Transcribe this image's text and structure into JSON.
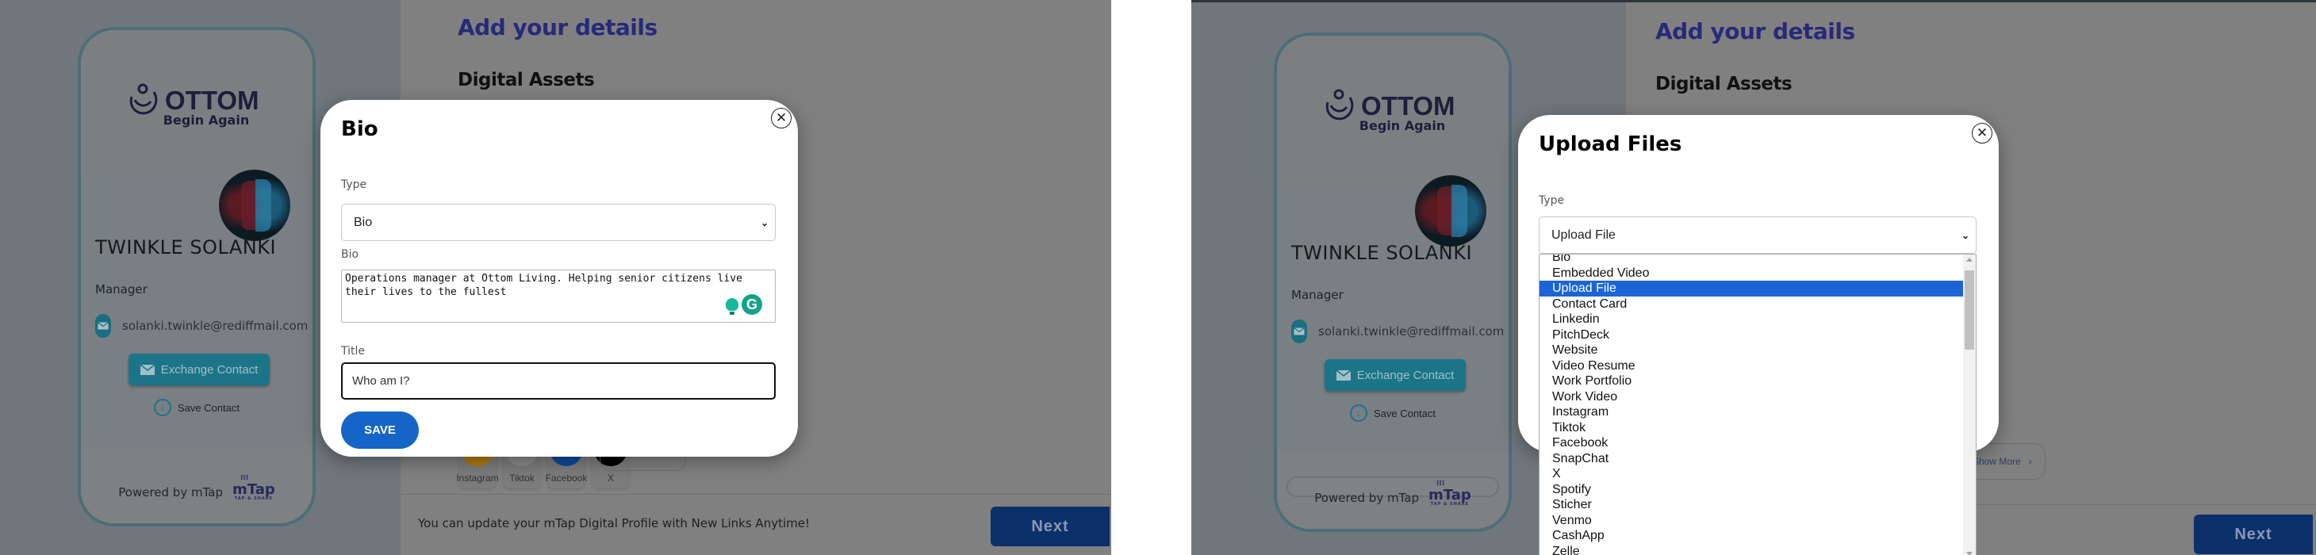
{
  "shared": {
    "profile": {
      "logo_word": "OTTOM",
      "logo_tagline": "Begin Again",
      "name": "TWINKLE SOLANKI",
      "role": "Manager",
      "email": "solanki.twinkle@rediffmail.com",
      "exchange_contact_label": "Exchange Contact",
      "save_contact_label": "Save Contact",
      "powered_by": "Powered by mTap",
      "mtap_logo": "mTap",
      "mtap_tagline": "TAP & SHARE"
    },
    "page_title": "Add your details",
    "section_title": "Digital Assets",
    "assets": [
      {
        "label": "Instagram",
        "color": "#b07a10"
      },
      {
        "label": "Tiktok",
        "color": "#8a8a8a"
      },
      {
        "label": "Facebook",
        "color": "#0b4a9c"
      },
      {
        "label": "X",
        "color": "#000000"
      }
    ],
    "show_more_label": "Show More",
    "footer_note": "You can update your mTap Digital Profile with New Links Anytime!",
    "next_label": "Next"
  },
  "left_modal": {
    "title": "Bio",
    "type_label": "Type",
    "type_value": "Bio",
    "bio_label": "Bio",
    "bio_value": "Operations manager at Ottom Living. Helping senior citizens live their lives to the fullest",
    "title_label": "Title",
    "title_value": "Who am I?",
    "save_label": "SAVE"
  },
  "right_modal": {
    "title": "Upload Files",
    "type_label": "Type",
    "type_value": "Upload File",
    "options": [
      "Bio",
      "Embedded Video",
      "Upload File",
      "Contact Card",
      "Linkedin",
      "PitchDeck",
      "Website",
      "Video Resume",
      "Work Portfolio",
      "Work Video",
      "Instagram",
      "Tiktok",
      "Facebook",
      "SnapChat",
      "X",
      "Spotify",
      "Sticher",
      "Venmo",
      "CashApp",
      "Zelle"
    ],
    "selected_option": "Upload File"
  },
  "colors": {
    "heading": "#27297a",
    "accent_teal": "#1c7488",
    "save_blue": "#1565c8",
    "next_blue": "#0c306a",
    "selected_option_bg": "#1c64d6"
  }
}
